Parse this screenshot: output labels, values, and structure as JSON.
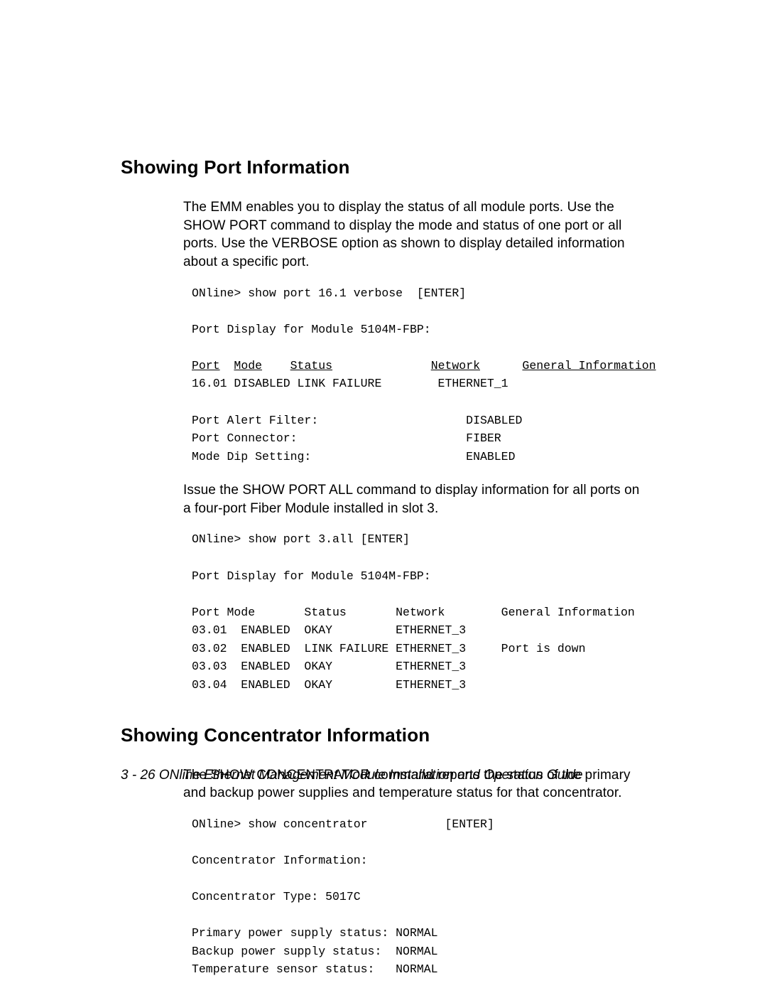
{
  "section1": {
    "heading": "Showing Port Information",
    "para1": "The EMM enables you to display the status of all module ports. Use the SHOW PORT command to display the mode and status of one port or all ports.   Use the VERBOSE option as shown to display detailed information about a specific port.",
    "term1_l1": "ONline> show port 16.1 verbose  [ENTER]",
    "term1_l2": "Port Display for Module 5104M-FBP:",
    "term1_h_port": "Port",
    "term1_h_mode": "Mode",
    "term1_h_status": "Status",
    "term1_h_network": "Network",
    "term1_h_gi": "General Information",
    "term1_l4": "16.01 DISABLED LINK FAILURE        ETHERNET_1",
    "term1_l5": "Port Alert Filter:                     DISABLED",
    "term1_l6": "Port Connector:                        FIBER",
    "term1_l7": "Mode Dip Setting:                      ENABLED",
    "para2": "Issue the SHOW PORT ALL command to display information for all ports on a four-port Fiber Module installed in slot 3.",
    "term2_l1": "ONline> show port 3.all [ENTER]",
    "term2_l2": "Port Display for Module 5104M-FBP:",
    "term2_l3": "Port Mode       Status       Network        General Information",
    "term2_l4": "03.01  ENABLED  OKAY         ETHERNET_3",
    "term2_l5": "03.02  ENABLED  LINK FAILURE ETHERNET_3     Port is down",
    "term2_l6": "03.03  ENABLED  OKAY         ETHERNET_3",
    "term2_l7": "03.04  ENABLED  OKAY         ETHERNET_3"
  },
  "section2": {
    "heading": "Showing Concentrator Information",
    "para1": "The SHOW CONCENTRATOR command reports the status of the primary and backup power supplies and temperature status for that concentrator.",
    "term_l1": "ONline> show concentrator           [ENTER]",
    "term_l2": "",
    "term_l3": "Concentrator Information:",
    "term_l4": "Concentrator Type: 5017C",
    "term_l5": "Primary power supply status: NORMAL",
    "term_l6": "Backup power supply status:  NORMAL",
    "term_l7": "Temperature sensor status:   NORMAL"
  },
  "footer": "3 - 26  ONline Ethernet Management Module Installation and Operation Guide"
}
